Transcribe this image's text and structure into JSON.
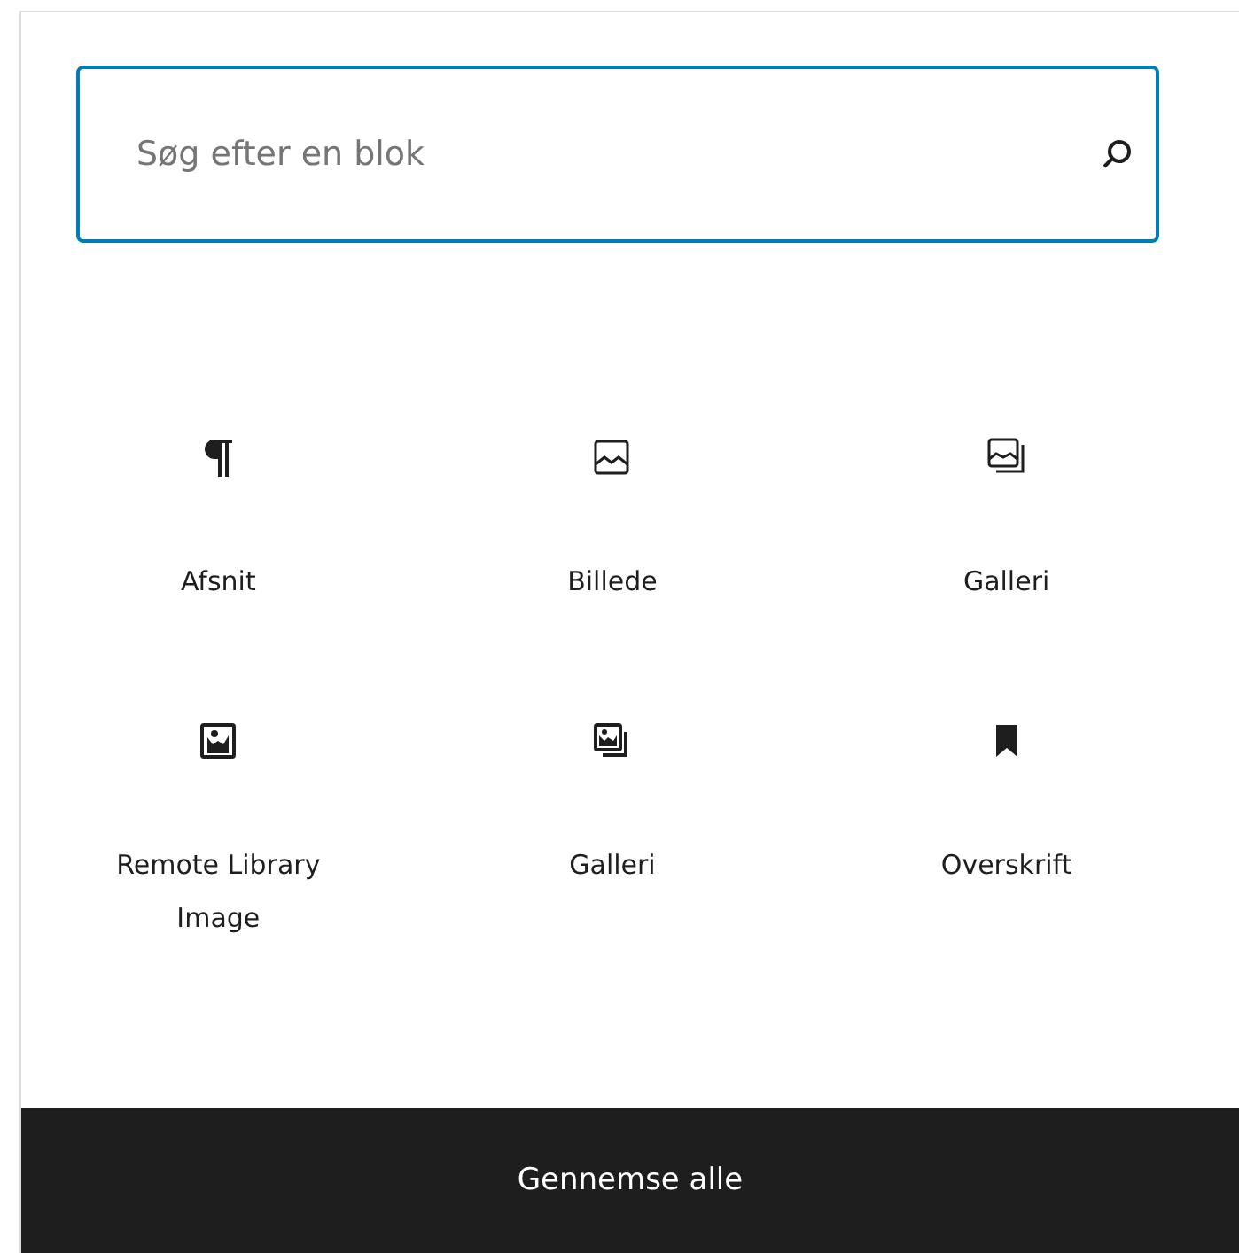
{
  "search": {
    "placeholder": "Søg efter en blok"
  },
  "blocks": [
    {
      "label": "Afsnit",
      "kind": "paragraph"
    },
    {
      "label": "Billede",
      "kind": "image"
    },
    {
      "label": "Galleri",
      "kind": "gallery"
    },
    {
      "label": "Remote Library Image",
      "kind": "photo"
    },
    {
      "label": "Galleri",
      "kind": "photos"
    },
    {
      "label": "Overskrift",
      "kind": "heading"
    }
  ],
  "footer": {
    "button": "Gennemse alle"
  }
}
